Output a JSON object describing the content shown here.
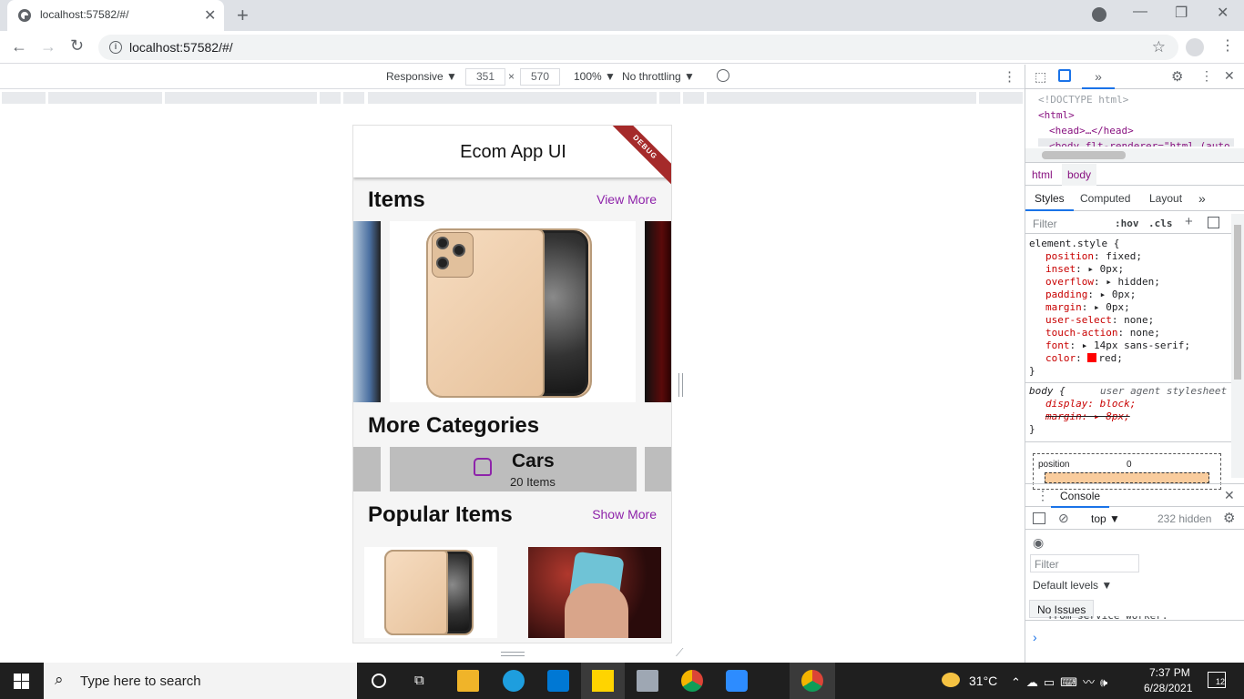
{
  "browser": {
    "tab_title": "localhost:57582/#/",
    "url": "localhost:57582/#/",
    "new_tab": "+",
    "close_tab": "✕"
  },
  "device_toolbar": {
    "mode": "Responsive ▼",
    "width": "351",
    "times": "×",
    "height": "570",
    "zoom": "100% ▼",
    "throttle": "No throttling ▼"
  },
  "app": {
    "title": "Ecom App UI",
    "debug": "DEBUG",
    "items_heading": "Items",
    "view_more": "View More",
    "categories_heading": "More Categories",
    "category": {
      "name": "Cars",
      "count": "20 Items"
    },
    "popular_heading": "Popular Items",
    "show_more": "Show More"
  },
  "devtools": {
    "elements": [
      "<!DOCTYPE html>",
      "<html>",
      "<head>…</head>",
      "<body flt-renderer=\"html (auto"
    ],
    "breadcrumb": [
      "html",
      "body"
    ],
    "tabs": [
      "Styles",
      "Computed",
      "Layout",
      "»"
    ],
    "filter_placeholder": "Filter",
    "hov": ":hov",
    "cls": ".cls",
    "element_style_selector": "element.style {",
    "styles": [
      {
        "p": "position",
        "v": "fixed;"
      },
      {
        "p": "inset",
        "v": "▸ 0px;"
      },
      {
        "p": "overflow",
        "v": "▸ hidden;"
      },
      {
        "p": "padding",
        "v": "▸ 0px;"
      },
      {
        "p": "margin",
        "v": "▸ 0px;"
      },
      {
        "p": "user-select",
        "v": "none;"
      },
      {
        "p": "touch-action",
        "v": "none;"
      },
      {
        "p": "font",
        "v": "▸ 14px sans-serif;"
      },
      {
        "p": "color",
        "v": "red;"
      }
    ],
    "close_brace": "}",
    "body_selector": "body {",
    "ua_label": "user agent stylesheet",
    "ua_display": "display: block;",
    "ua_margin": "margin: ▸ 8px;",
    "box_label": "position",
    "box_value": "0",
    "console_tab": "Console",
    "context": "top ▼",
    "hidden_count": "232 hidden",
    "console_filter": "Filter",
    "levels": "Default levels ▼",
    "no_issues": "No Issues",
    "console_line": "from service worker.",
    "prompt": "›"
  },
  "taskbar": {
    "search_placeholder": "Type here to search",
    "temp": "31°C",
    "time": "7:37 PM",
    "date": "6/28/2021",
    "notif": "12"
  }
}
